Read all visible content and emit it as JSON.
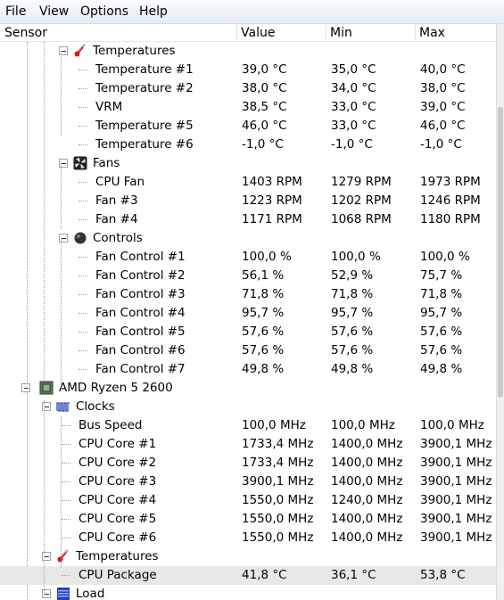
{
  "menu": [
    "File",
    "View",
    "Options",
    "Help"
  ],
  "columns": {
    "sensor": "Sensor",
    "value": "Value",
    "min": "Min",
    "max": "Max"
  },
  "rows": [
    {
      "kind": "group",
      "icon": "thermometer-icon",
      "label": "Temperatures",
      "value": "",
      "min": "",
      "max": ""
    },
    {
      "kind": "leaf",
      "label": "Temperature #1",
      "value": "39,0 °C",
      "min": "35,0 °C",
      "max": "40,0 °C"
    },
    {
      "kind": "leaf",
      "label": "Temperature #2",
      "value": "38,0 °C",
      "min": "34,0 °C",
      "max": "38,0 °C"
    },
    {
      "kind": "leaf",
      "label": "VRM",
      "value": "38,5 °C",
      "min": "33,0 °C",
      "max": "39,0 °C"
    },
    {
      "kind": "leaf",
      "label": "Temperature #5",
      "value": "46,0 °C",
      "min": "33,0 °C",
      "max": "46,0 °C"
    },
    {
      "kind": "leaf",
      "label": "Temperature #6",
      "value": "-1,0 °C",
      "min": "-1,0 °C",
      "max": "-1,0 °C"
    },
    {
      "kind": "group",
      "icon": "fan-icon",
      "label": "Fans",
      "value": "",
      "min": "",
      "max": ""
    },
    {
      "kind": "leaf",
      "label": "CPU Fan",
      "value": "1403 RPM",
      "min": "1279 RPM",
      "max": "1973 RPM"
    },
    {
      "kind": "leaf",
      "label": "Fan #3",
      "value": "1223 RPM",
      "min": "1202 RPM",
      "max": "1246 RPM"
    },
    {
      "kind": "leaf",
      "label": "Fan #4",
      "value": "1171 RPM",
      "min": "1068 RPM",
      "max": "1180 RPM"
    },
    {
      "kind": "group",
      "icon": "control-knob-icon",
      "label": "Controls",
      "value": "",
      "min": "",
      "max": ""
    },
    {
      "kind": "leaf",
      "label": "Fan Control #1",
      "value": "100,0 %",
      "min": "100,0 %",
      "max": "100,0 %"
    },
    {
      "kind": "leaf",
      "label": "Fan Control #2",
      "value": "56,1 %",
      "min": "52,9 %",
      "max": "75,7 %"
    },
    {
      "kind": "leaf",
      "label": "Fan Control #3",
      "value": "71,8 %",
      "min": "71,8 %",
      "max": "71,8 %"
    },
    {
      "kind": "leaf",
      "label": "Fan Control #4",
      "value": "95,7 %",
      "min": "95,7 %",
      "max": "95,7 %"
    },
    {
      "kind": "leaf",
      "label": "Fan Control #5",
      "value": "57,6 %",
      "min": "57,6 %",
      "max": "57,6 %"
    },
    {
      "kind": "leaf",
      "label": "Fan Control #6",
      "value": "57,6 %",
      "min": "57,6 %",
      "max": "57,6 %"
    },
    {
      "kind": "leaf",
      "label": "Fan Control #7",
      "value": "49,8 %",
      "min": "49,8 %",
      "max": "49,8 %"
    },
    {
      "kind": "hardware",
      "icon": "cpu-icon",
      "label": "AMD Ryzen 5 2600",
      "value": "",
      "min": "",
      "max": ""
    },
    {
      "kind": "group",
      "icon": "clock-icon",
      "label": "Clocks",
      "value": "",
      "min": "",
      "max": ""
    },
    {
      "kind": "leaf",
      "label": "Bus Speed",
      "value": "100,0 MHz",
      "min": "100,0 MHz",
      "max": "100,0 MHz"
    },
    {
      "kind": "leaf",
      "label": "CPU Core #1",
      "value": "1733,4 MHz",
      "min": "1400,0 MHz",
      "max": "3900,1 MHz"
    },
    {
      "kind": "leaf",
      "label": "CPU Core #2",
      "value": "1733,4 MHz",
      "min": "1400,0 MHz",
      "max": "3900,1 MHz"
    },
    {
      "kind": "leaf",
      "label": "CPU Core #3",
      "value": "3900,1 MHz",
      "min": "1400,0 MHz",
      "max": "3900,1 MHz"
    },
    {
      "kind": "leaf",
      "label": "CPU Core #4",
      "value": "1550,0 MHz",
      "min": "1240,0 MHz",
      "max": "3900,1 MHz"
    },
    {
      "kind": "leaf",
      "label": "CPU Core #5",
      "value": "1550,0 MHz",
      "min": "1400,0 MHz",
      "max": "3900,1 MHz"
    },
    {
      "kind": "leaf",
      "label": "CPU Core #6",
      "value": "1550,0 MHz",
      "min": "1400,0 MHz",
      "max": "3900,1 MHz"
    },
    {
      "kind": "group",
      "icon": "thermometer-icon",
      "label": "Temperatures",
      "value": "",
      "min": "",
      "max": ""
    },
    {
      "kind": "leaf",
      "label": "CPU Package",
      "value": "41,8 °C",
      "min": "36,1 °C",
      "max": "53,8 °C",
      "selected": true
    },
    {
      "kind": "group",
      "icon": "load-icon",
      "label": "Load",
      "value": "",
      "min": "",
      "max": ""
    }
  ]
}
